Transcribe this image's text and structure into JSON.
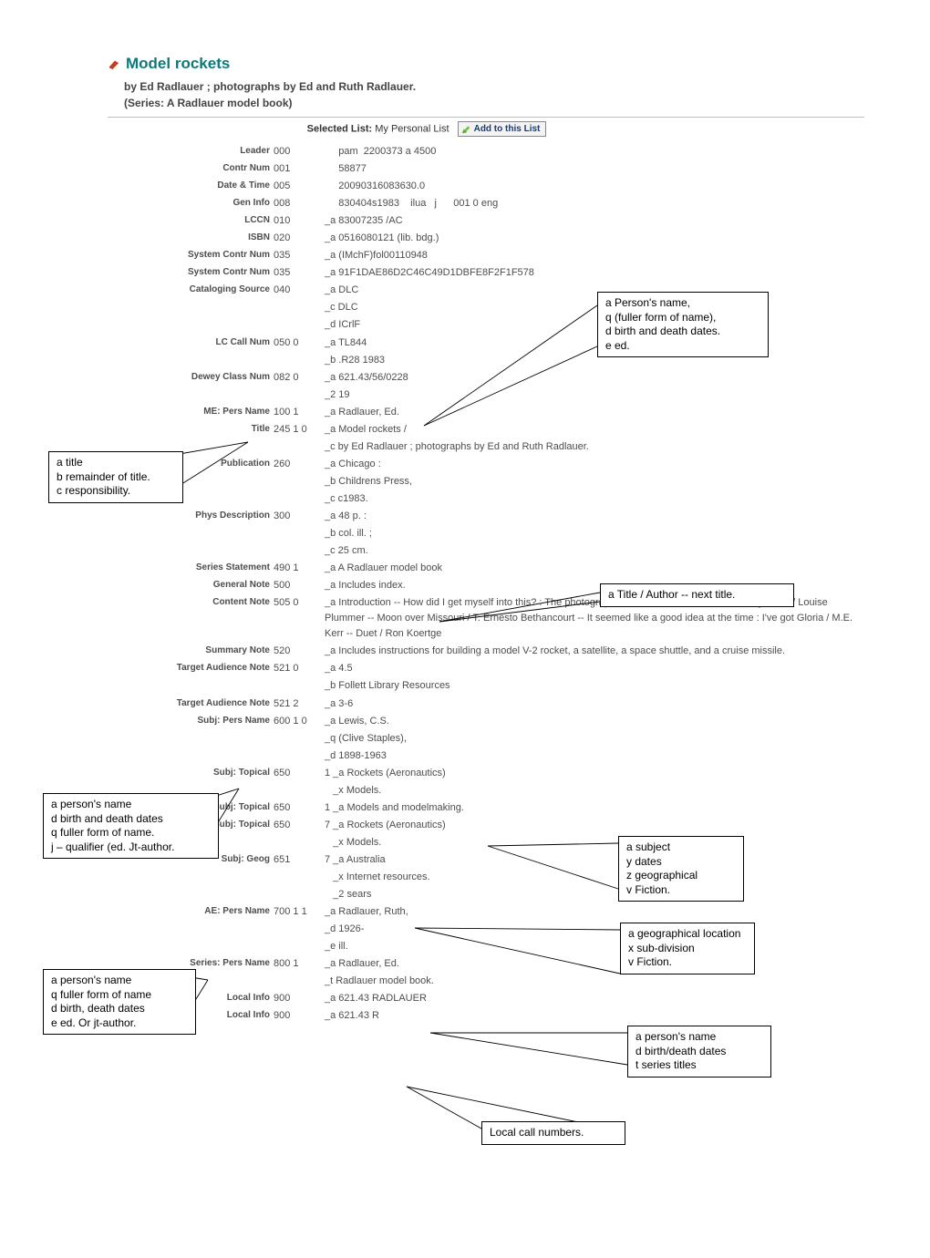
{
  "header": {
    "title": "Model rockets",
    "byline": "by Ed Radlauer ; photographs by Ed and Ruth Radlauer.",
    "series": "(Series: A Radlauer model book)"
  },
  "selected_list": {
    "label": "Selected List:",
    "value": "My Personal List",
    "button": "Add to this List"
  },
  "rows": [
    {
      "lab": "Leader",
      "tag": "000",
      "val": "     pam  2200373 a 4500"
    },
    {
      "lab": "Contr Num",
      "tag": "001",
      "val": "     58877"
    },
    {
      "lab": "Date & Time",
      "tag": "005",
      "val": "     20090316083630.0"
    },
    {
      "lab": "Gen Info",
      "tag": "008",
      "val": "     830404s1983    ilua   j      001 0 eng"
    },
    {
      "lab": "LCCN",
      "tag": "010",
      "val": "_a 83007235 /AC"
    },
    {
      "lab": "ISBN",
      "tag": "020",
      "val": "_a 0516080121 (lib. bdg.)"
    },
    {
      "lab": "System Contr Num",
      "tag": "035",
      "val": "_a (IMchF)fol00110948"
    },
    {
      "lab": "System Contr Num",
      "tag": "035",
      "val": "_a 91F1DAE86D2C46C49D1DBFE8F2F1F578"
    },
    {
      "lab": "Cataloging Source",
      "tag": "040",
      "val": "_a DLC"
    },
    {
      "lab": "",
      "tag": "",
      "val": "_c DLC"
    },
    {
      "lab": "",
      "tag": "",
      "val": "_d ICrlF"
    },
    {
      "lab": "LC Call Num",
      "tag": "050 0",
      "val": "_a TL844"
    },
    {
      "lab": "",
      "tag": "",
      "val": "_b .R28 1983"
    },
    {
      "lab": "Dewey Class Num",
      "tag": "082 0",
      "val": "_a 621.43/56/0228"
    },
    {
      "lab": "",
      "tag": "",
      "val": "_2 19"
    },
    {
      "lab": "ME: Pers Name",
      "tag": "100 1",
      "val": "_a Radlauer, Ed."
    },
    {
      "lab": "Title",
      "tag": "245 1 0",
      "val": "_a Model rockets /"
    },
    {
      "lab": "",
      "tag": "",
      "val": "_c by Ed Radlauer ; photographs by Ed and Ruth Radlauer."
    },
    {
      "lab": "Publication",
      "tag": "260",
      "val": "_a Chicago :"
    },
    {
      "lab": "",
      "tag": "",
      "val": "_b Childrens Press,"
    },
    {
      "lab": "",
      "tag": "",
      "val": "_c c1983."
    },
    {
      "lab": "Phys Description",
      "tag": "300",
      "val": "_a 48 p. :"
    },
    {
      "lab": "",
      "tag": "",
      "val": "_b col. ill. ;"
    },
    {
      "lab": "",
      "tag": "",
      "val": "_c 25 cm."
    },
    {
      "lab": "Series Statement",
      "tag": "490 1",
      "val": "_a A Radlauer model book"
    },
    {
      "lab": "General Note",
      "tag": "500",
      "val": "_a Includes index."
    },
    {
      "lab": "Content Note",
      "tag": "505 0",
      "val": "_a Introduction -- How did I get myself into this? : The photograph / Will Weaver -- Bliss at the Burger Bar / Louise Plummer -- Moon over Missouri / T. Ernesto Bethancourt -- It seemed like a good idea at the time : I've got Gloria / M.E. Kerr -- Duet / Ron Koertge"
    },
    {
      "lab": "Summary Note",
      "tag": "520",
      "val": "_a Includes instructions for building a model V-2 rocket, a satellite, a space shuttle, and a cruise missile."
    },
    {
      "lab": "Target Audience Note",
      "tag": "521 0",
      "val": "_a 4.5"
    },
    {
      "lab": "",
      "tag": "",
      "val": "_b Follett Library Resources"
    },
    {
      "lab": "Target Audience Note",
      "tag": "521 2",
      "val": "_a 3-6"
    },
    {
      "lab": "Subj: Pers Name",
      "tag": "600 1 0",
      "val": "_a Lewis, C.S."
    },
    {
      "lab": "",
      "tag": "",
      "val": "_q (Clive Staples),"
    },
    {
      "lab": "",
      "tag": "",
      "val": "_d 1898-1963"
    },
    {
      "lab": "Subj: Topical",
      "tag": "650",
      "val": "1 _a Rockets (Aeronautics)"
    },
    {
      "lab": "",
      "tag": "",
      "val": "   _x Models."
    },
    {
      "lab": "Subj: Topical",
      "tag": "650",
      "val": "1 _a Models and modelmaking."
    },
    {
      "lab": "Subj: Topical",
      "tag": "650",
      "val": "7 _a Rockets (Aeronautics)"
    },
    {
      "lab": "",
      "tag": "",
      "val": "   _x Models."
    },
    {
      "lab": "Subj: Geog",
      "tag": "651",
      "val": "7 _a Australia"
    },
    {
      "lab": "",
      "tag": "",
      "val": "   _x Internet resources."
    },
    {
      "lab": "",
      "tag": "",
      "val": "   _2 sears"
    },
    {
      "lab": "AE: Pers Name",
      "tag": "700 1 1",
      "val": "_a Radlauer, Ruth,"
    },
    {
      "lab": "",
      "tag": "",
      "val": "_d 1926-"
    },
    {
      "lab": "",
      "tag": "",
      "val": "_e ill."
    },
    {
      "lab": "Series: Pers Name",
      "tag": "800 1",
      "val": "_a Radlauer, Ed."
    },
    {
      "lab": "",
      "tag": "",
      "val": "_t Radlauer model book."
    },
    {
      "lab": "Local Info",
      "tag": "900",
      "val": "_a 621.43 RADLAUER"
    },
    {
      "lab": "Local Info",
      "tag": "900",
      "val": "_a 621.43 R"
    }
  ],
  "callouts": {
    "c1": "a Person's name,\nq (fuller form of name),\nd birth and death dates.\ne ed.",
    "c2": "a title\nb remainder of title.\nc responsibility.",
    "c3": "a Title / Author -- next title.",
    "c4": "a person's name\nd birth and death dates\nq fuller form of name.\nj – qualifier (ed.  Jt-author.",
    "c5": "a subject\ny dates\nz geographical\nv Fiction.",
    "c6": "a geographical location\nx sub-division\nv Fiction.",
    "c7": "a person's name\nq fuller form of name\nd birth, death dates\ne ed. Or jt-author.",
    "c8": "a person's name\nd birth/death dates\nt series titles",
    "c9": "Local call numbers."
  }
}
